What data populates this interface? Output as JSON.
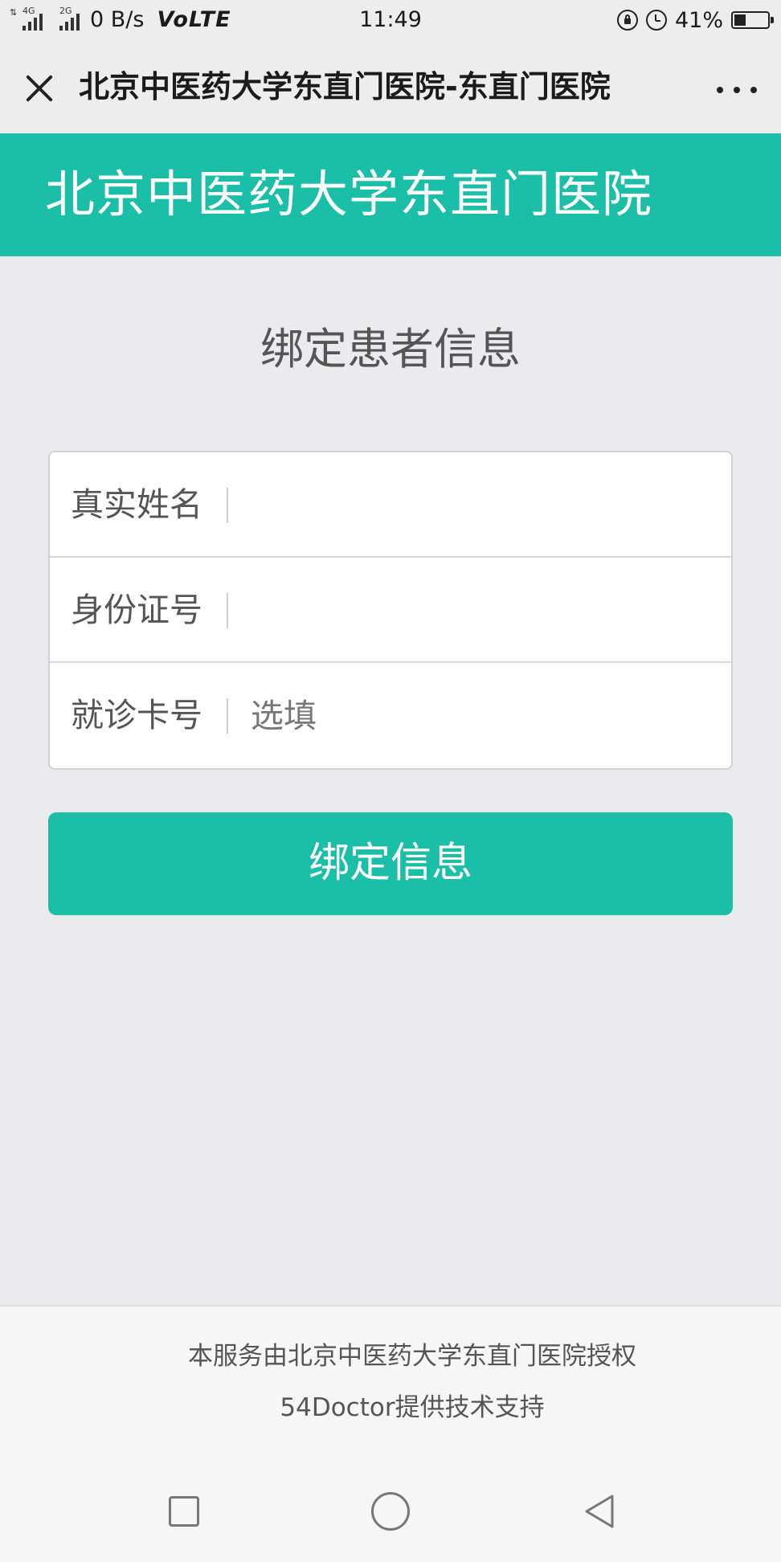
{
  "status_bar": {
    "net1": "4G",
    "net2": "2G",
    "speed": "0 B/s",
    "volte": "VoLTE",
    "time": "11:49",
    "battery": "41%",
    "battery_level": 0.41
  },
  "title_bar": {
    "title": "北京中医药大学东直门医院-东直门医院"
  },
  "banner": {
    "title": "北京中医药大学东直门医院"
  },
  "form": {
    "heading": "绑定患者信息",
    "fields": [
      {
        "label": "真实姓名",
        "placeholder": ""
      },
      {
        "label": "身份证号",
        "placeholder": ""
      },
      {
        "label": "就诊卡号",
        "placeholder": "选填"
      }
    ],
    "submit_label": "绑定信息"
  },
  "footer": {
    "line1": "本服务由北京中医药大学东直门医院授权",
    "line2": "54Doctor提供技术支持"
  },
  "colors": {
    "accent": "#1bbfa8",
    "background": "#ebebed"
  }
}
